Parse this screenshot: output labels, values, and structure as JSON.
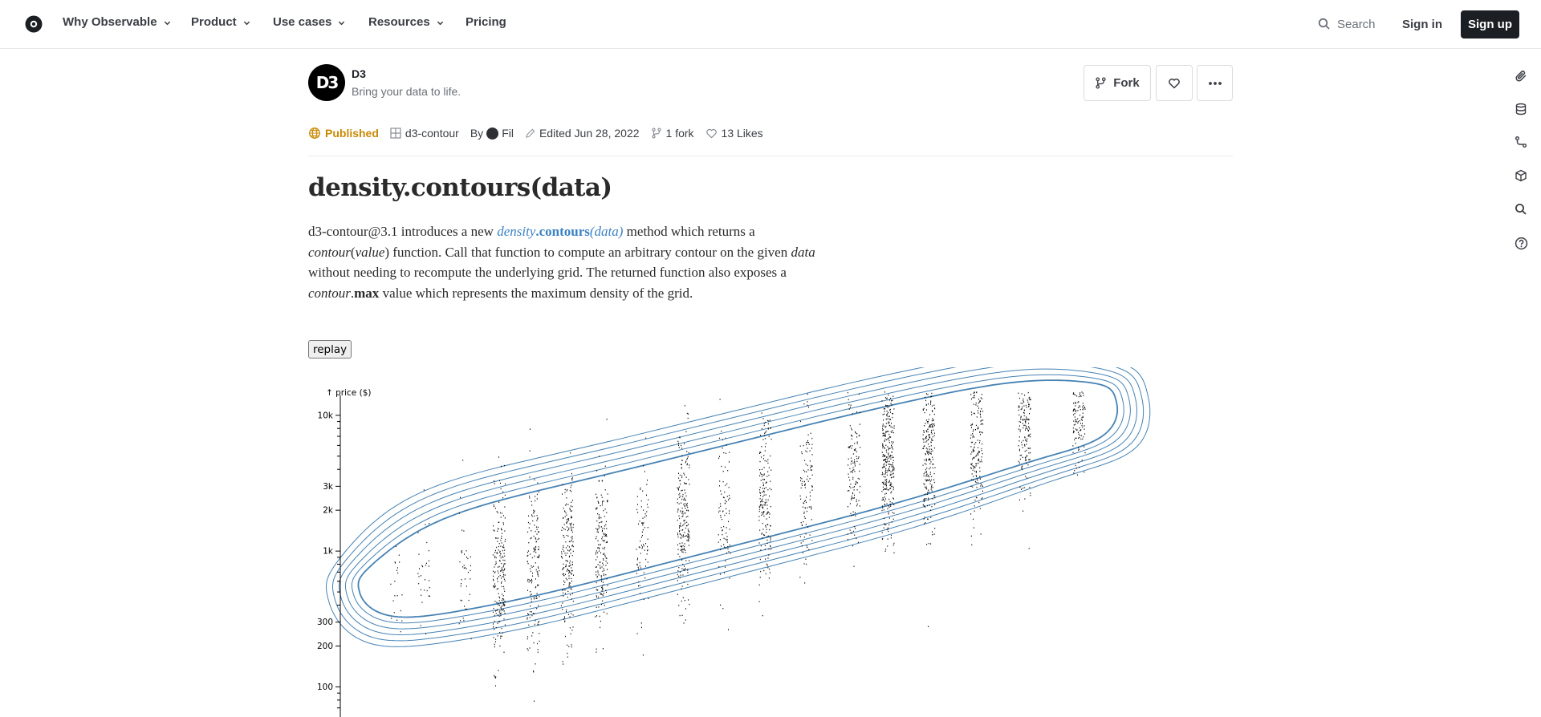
{
  "nav": {
    "items": [
      {
        "label": "Why Observable",
        "chevron": true
      },
      {
        "label": "Product",
        "chevron": true
      },
      {
        "label": "Use cases",
        "chevron": true
      },
      {
        "label": "Resources",
        "chevron": true
      },
      {
        "label": "Pricing",
        "chevron": false
      }
    ],
    "search_label": "Search",
    "signin_label": "Sign in",
    "signup_label": "Sign up"
  },
  "rail_icons": [
    "paperclip-icon",
    "database-icon",
    "branch-icon",
    "cube-icon",
    "search-icon",
    "help-icon"
  ],
  "notebook": {
    "author_name": "D3",
    "author_avatar_text": "D3",
    "author_bio": "Bring your data to life.",
    "fork_label": "Fork",
    "status": "Published",
    "collection": "d3-contour",
    "by_label": "By",
    "by_user": "Fil",
    "edited": "Edited Jun 28, 2022",
    "forks": "1 fork",
    "likes": "13 Likes"
  },
  "content": {
    "title": "density.contours(data)",
    "p1_a": "d3-contour@3.1 introduces a new ",
    "p1_density": "density",
    "p1_dot1": ".",
    "p1_contours": "contours",
    "p1_paren": "(data)",
    "p1_b": " method which returns a ",
    "p1_contour": "contour",
    "p1_lp": "(",
    "p1_value": "value",
    "p1_c": ") function. Call that function to compute an arbitrary contour on the given ",
    "p1_data": "data",
    "p1_d": " without needing to recompute the underlying grid. The returned function also exposes a ",
    "p1_contour2": "contour",
    "p1_dot2": ".",
    "p1_max": "max",
    "p1_e": " value which represents the maximum density of the grid.",
    "replay_label": "replay"
  },
  "colors": {
    "accent": "#3b82c4",
    "published": "#c98a05",
    "contour": "#4682b4"
  },
  "chart_data": {
    "type": "scatter",
    "ylabel": "↑ price ($)",
    "yscale": "log",
    "ylim": [
      60,
      15000
    ],
    "yticks_labeled": [
      {
        "value": 100,
        "label": "100"
      },
      {
        "value": 200,
        "label": "200"
      },
      {
        "value": 300,
        "label": "300"
      },
      {
        "value": 1000,
        "label": "1k"
      },
      {
        "value": 2000,
        "label": "2k"
      },
      {
        "value": 3000,
        "label": "3k"
      },
      {
        "value": 10000,
        "label": "10k"
      }
    ],
    "yticks_minor": [
      70,
      80,
      90,
      400,
      500,
      600,
      700,
      800,
      900,
      4000,
      5000,
      6000,
      7000,
      8000,
      9000
    ],
    "point_clusters": [
      {
        "x": 0.08,
        "y": 600,
        "n": 20,
        "spread": 0.18
      },
      {
        "x": 0.12,
        "y": 650,
        "n": 30,
        "spread": 0.22
      },
      {
        "x": 0.18,
        "y": 700,
        "n": 40,
        "spread": 0.25
      },
      {
        "x": 0.23,
        "y": 700,
        "n": 220,
        "spread": 0.32
      },
      {
        "x": 0.28,
        "y": 780,
        "n": 160,
        "spread": 0.32
      },
      {
        "x": 0.33,
        "y": 900,
        "n": 200,
        "spread": 0.32
      },
      {
        "x": 0.38,
        "y": 1000,
        "n": 180,
        "spread": 0.3
      },
      {
        "x": 0.44,
        "y": 1250,
        "n": 80,
        "spread": 0.28
      },
      {
        "x": 0.5,
        "y": 1600,
        "n": 220,
        "spread": 0.3
      },
      {
        "x": 0.56,
        "y": 1800,
        "n": 90,
        "spread": 0.3
      },
      {
        "x": 0.62,
        "y": 2600,
        "n": 180,
        "spread": 0.32
      },
      {
        "x": 0.68,
        "y": 3100,
        "n": 110,
        "spread": 0.3
      },
      {
        "x": 0.75,
        "y": 4200,
        "n": 130,
        "spread": 0.25
      },
      {
        "x": 0.8,
        "y": 4800,
        "n": 320,
        "spread": 0.32
      },
      {
        "x": 0.86,
        "y": 6000,
        "n": 240,
        "spread": 0.3
      },
      {
        "x": 0.93,
        "y": 7500,
        "n": 200,
        "spread": 0.3
      },
      {
        "x": 1.0,
        "y": 9500,
        "n": 200,
        "spread": 0.28
      },
      {
        "x": 1.08,
        "y": 11000,
        "n": 160,
        "spread": 0.22
      }
    ],
    "outliers": [
      {
        "x": 1.33,
        "y": 9000
      },
      {
        "x": 1.47,
        "y": 11500
      },
      {
        "x": 1.5,
        "y": 11600
      }
    ],
    "contour_levels": 6
  }
}
